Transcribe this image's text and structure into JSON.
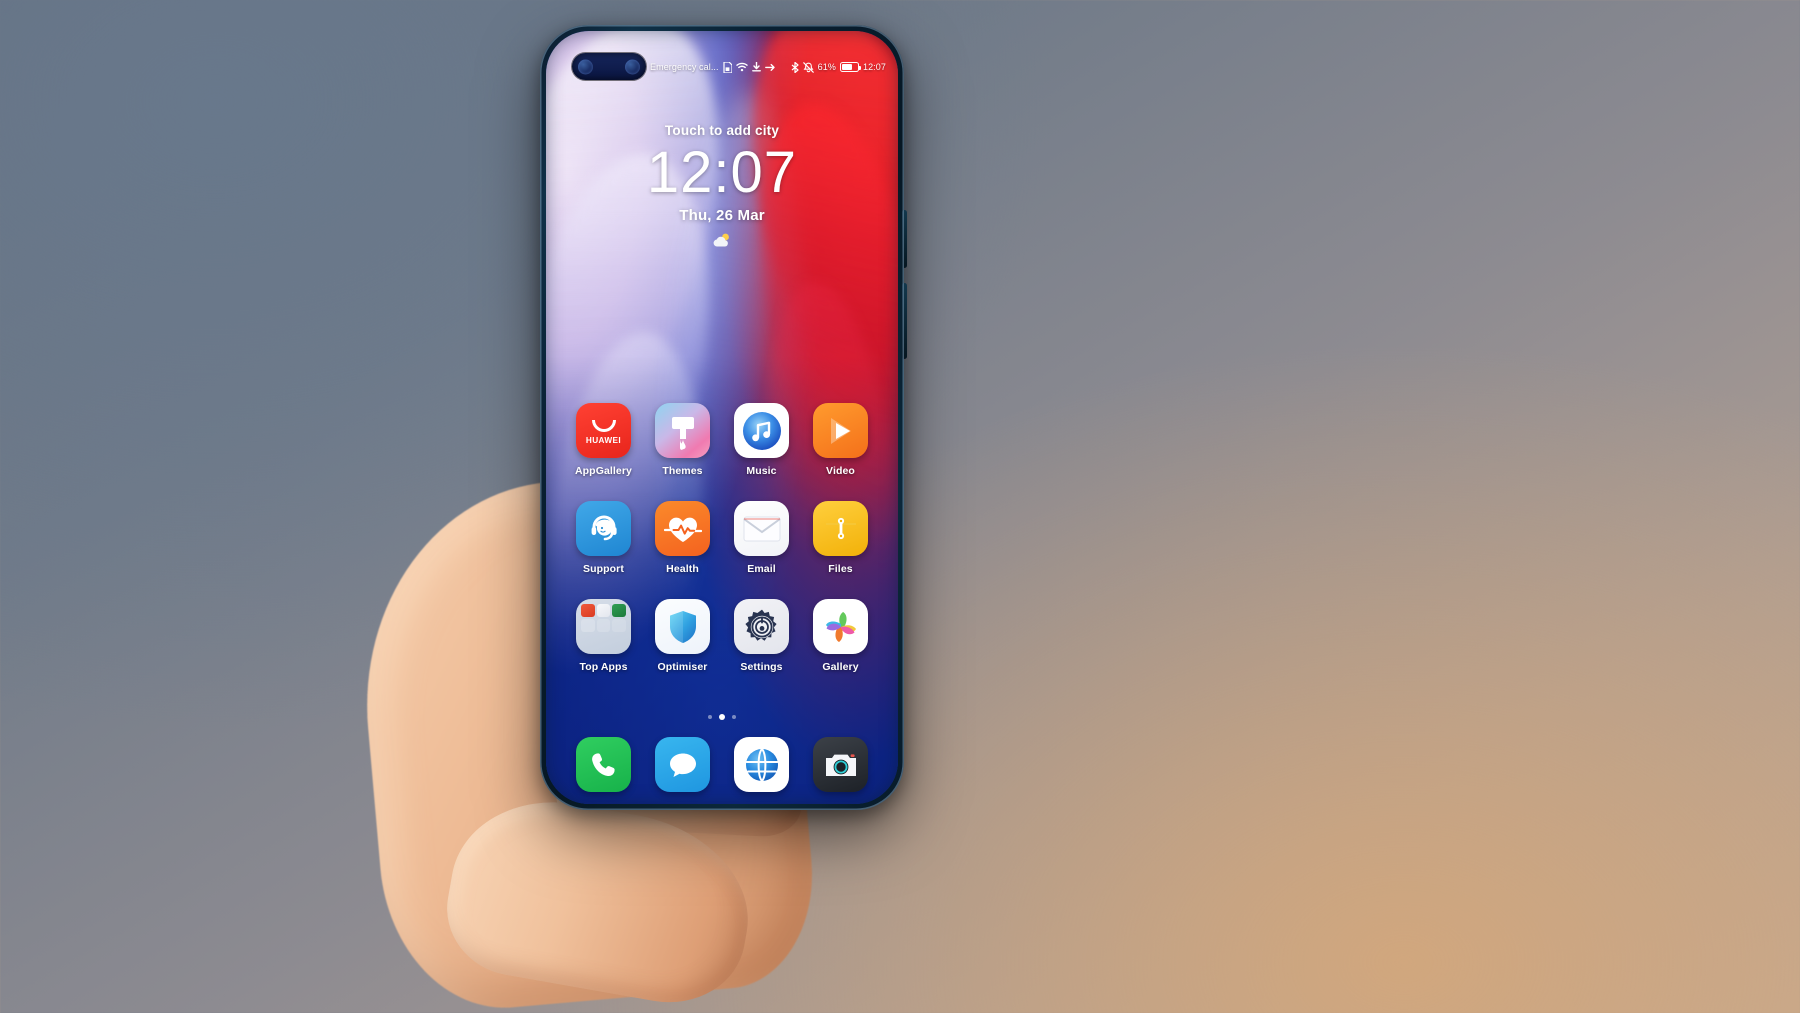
{
  "scene": {
    "description": "Hand holding a Huawei smartphone showing its home screen",
    "background_colors": {
      "top_left": "#64707f",
      "bottom_right": "#c0a894"
    }
  },
  "phone": {
    "frame_color": "#0a2233",
    "wallpaper_colors": {
      "left": "#cdb9e6",
      "center": "#0f2fa6",
      "right": "#ef1f24"
    }
  },
  "status_bar": {
    "carrier": "Emergency cal...",
    "icons_left": [
      "sim-card-icon",
      "wifi-icon",
      "download-icon",
      "vpn-icon"
    ],
    "icons_right": [
      "bluetooth-icon",
      "mute-icon"
    ],
    "battery_percent": "61%",
    "time": "12:07"
  },
  "clock_widget": {
    "city_prompt": "Touch to add city",
    "time": "12:07",
    "date": "Thu, 26 Mar",
    "weather_icon": "partly-cloudy-icon"
  },
  "home_screen": {
    "rows": [
      [
        {
          "label": "AppGallery",
          "icon": "appgallery-icon",
          "brand_text": "HUAWEI",
          "color": "#ea2a1f"
        },
        {
          "label": "Themes",
          "icon": "themes-icon",
          "color": "#c9b8e8"
        },
        {
          "label": "Music",
          "icon": "music-icon",
          "color": "#2f7fe0"
        },
        {
          "label": "Video",
          "icon": "video-icon",
          "color": "#f4701a"
        }
      ],
      [
        {
          "label": "Support",
          "icon": "support-icon",
          "color": "#1f86d2"
        },
        {
          "label": "Health",
          "icon": "health-icon",
          "color": "#f4621f"
        },
        {
          "label": "Email",
          "icon": "email-icon",
          "color": "#ffffff"
        },
        {
          "label": "Files",
          "icon": "files-icon",
          "color": "#f2b109"
        }
      ],
      [
        {
          "label": "Top Apps",
          "icon": "top-apps-folder-icon",
          "color": "#c3cedd"
        },
        {
          "label": "Optimiser",
          "icon": "optimiser-icon",
          "color": "#3aa8dd"
        },
        {
          "label": "Settings",
          "icon": "settings-icon",
          "color": "#2b3550"
        },
        {
          "label": "Gallery",
          "icon": "gallery-icon",
          "color": "#ffffff"
        }
      ]
    ],
    "page_dots": {
      "count": 3,
      "active_index": 1
    },
    "dock": [
      {
        "label": "Phone",
        "icon": "phone-icon",
        "color": "#17b24a"
      },
      {
        "label": "Messages",
        "icon": "messages-icon",
        "color": "#1f96e0"
      },
      {
        "label": "Browser",
        "icon": "browser-globe-icon",
        "color": "#1f7fd6"
      },
      {
        "label": "Camera",
        "icon": "camera-icon",
        "color": "#1d2127"
      }
    ]
  }
}
